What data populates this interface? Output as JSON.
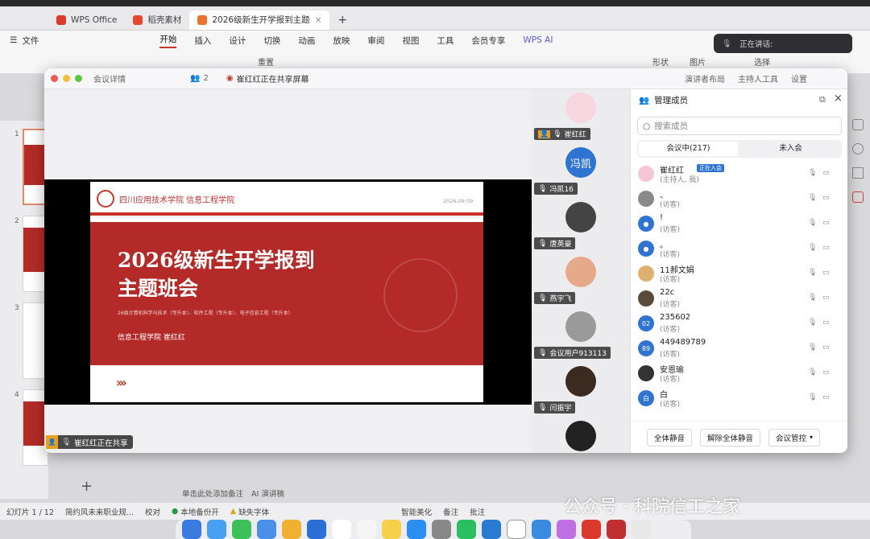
{
  "wps": {
    "tabs": [
      {
        "label": "WPS Office"
      },
      {
        "label": "稻壳素材"
      },
      {
        "label": "2026级新生开学报到主题"
      }
    ],
    "menu_file": "文件",
    "ribbon_tabs": [
      "开始",
      "插入",
      "设计",
      "切换",
      "动画",
      "放映",
      "审阅",
      "视图",
      "工具",
      "会员专享",
      "WPS AI"
    ],
    "toolbar_right": [
      "形状",
      "图片",
      "选择"
    ],
    "toolbar_left_label": "重置",
    "slide_numbers": [
      "1",
      "2",
      "3",
      "4"
    ],
    "notes_placeholder": "单击此处添加备注",
    "ai_notes": "AI 演讲稿",
    "status": {
      "slide_index": "幻灯片 1 / 12",
      "theme": "简约风未来职业规...",
      "proof": "校对",
      "backup": "本地备份开",
      "missing_font": "缺失字体",
      "beautify": "智能美化",
      "notes": "备注",
      "annotate": "批注"
    },
    "speaking_label": "正在讲话:"
  },
  "meeting": {
    "title_left": "会议详情",
    "title_count": "2",
    "sharing_title": "崔红红正在共享屏幕",
    "title_right": [
      "演讲者布局",
      "主持人工具",
      "设置"
    ],
    "stage_tag": "崔红红正在共享",
    "slide": {
      "school": "四川应用技术学院  信息工程学院",
      "date": "2026.09.09",
      "title_line1": "2026级新生开学报到",
      "title_line2": "主题班会",
      "majors": "26级计算机科学与技术（专升本）、软件工程（专升本）、电子信息工程（专升本）",
      "presenter": "信息工程学院  崔红红",
      "arrows": "›››"
    },
    "video_tiles": [
      {
        "name": "崔红红",
        "initials": "",
        "color": "#f7d6e0"
      },
      {
        "name": "冯凯16",
        "initials": "冯凯",
        "color": "#2f74d0"
      },
      {
        "name": "唐英豪",
        "initials": "",
        "color": "#444444"
      },
      {
        "name": "燕宇飞",
        "initials": "",
        "color": "#e6a98a"
      },
      {
        "name": "会议用户913113",
        "initials": "",
        "color": "#9a9a9a"
      },
      {
        "name": "闫振宇",
        "initials": "",
        "color": "#3a2a20"
      },
      {
        "name": "",
        "initials": "",
        "color": "#222222"
      }
    ],
    "panel": {
      "title": "管理成员",
      "search_placeholder": "搜索成员",
      "tab_in": "会议中(217)",
      "tab_out": "未入会",
      "members": [
        {
          "name": "崔红红",
          "role": "(主持人, 我)",
          "initials": "",
          "color": "#f5c6d3",
          "badge": "正在入会"
        },
        {
          "name": "、",
          "role": "(访客)",
          "initials": "",
          "color": "#8a8a8a"
        },
        {
          "name": "!",
          "role": "(访客)",
          "initials": "●",
          "color": "#2f74d0"
        },
        {
          "name": "。",
          "role": "(访客)",
          "initials": "●",
          "color": "#2f74d0"
        },
        {
          "name": "11郝文娟",
          "role": "(访客)",
          "initials": "",
          "color": "#e0b070"
        },
        {
          "name": "22c",
          "role": "(访客)",
          "initials": "",
          "color": "#5a4a3a"
        },
        {
          "name": "235602",
          "role": "(访客)",
          "initials": "02",
          "color": "#2f74d0"
        },
        {
          "name": "449489789",
          "role": "(访客)",
          "initials": "89",
          "color": "#2f74d0"
        },
        {
          "name": "安恩瑜",
          "role": "(访客)",
          "initials": "",
          "color": "#333333"
        },
        {
          "name": "白",
          "role": "(访客)",
          "initials": "白",
          "color": "#2f74d0"
        }
      ],
      "btn_mute_all": "全体静音",
      "btn_unmute_all": "解除全体静音",
      "btn_control": "会议管控"
    }
  },
  "watermark": "公众号 · 科院信工之家"
}
